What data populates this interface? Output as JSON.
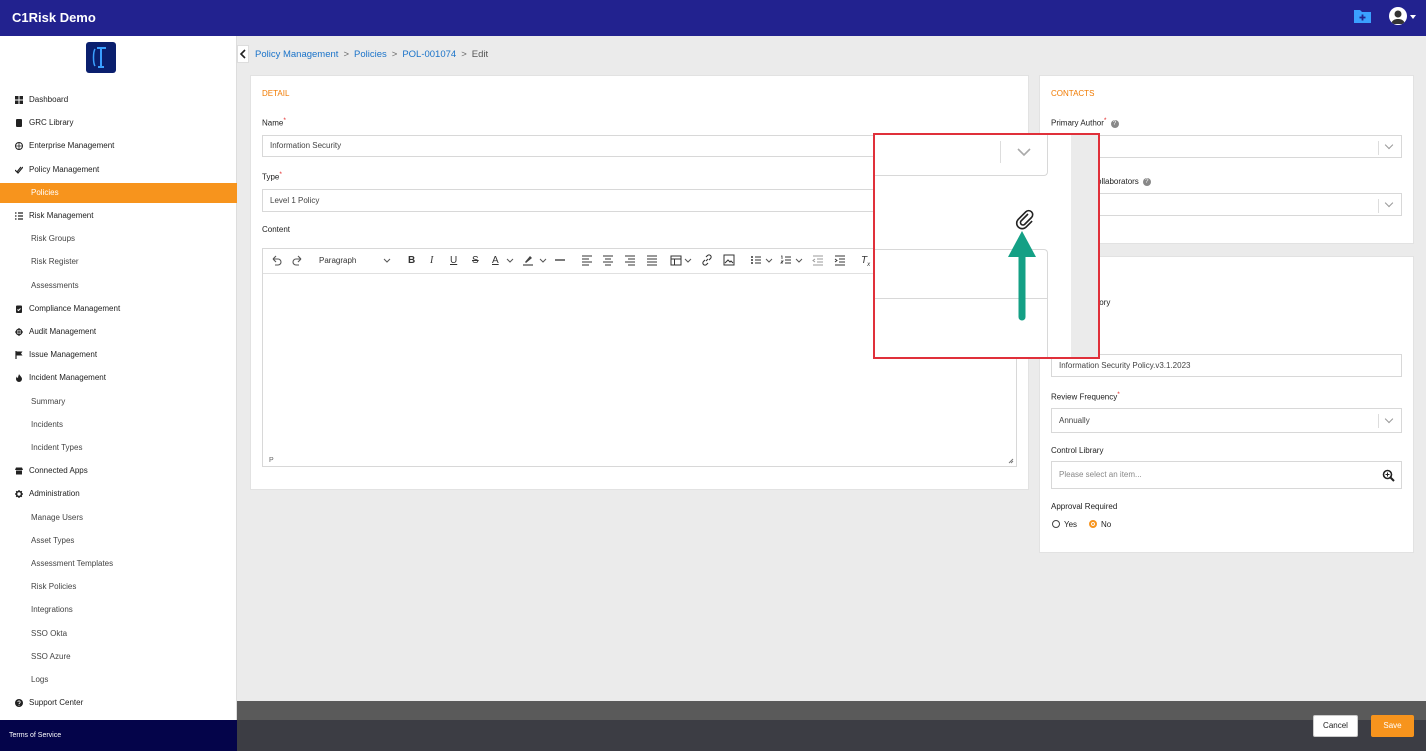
{
  "app": {
    "title": "C1Risk Demo"
  },
  "sidebar": {
    "items": [
      {
        "label": "Dashboard",
        "icon": "grid-icon"
      },
      {
        "label": "GRC Library",
        "icon": "book-icon"
      },
      {
        "label": "Enterprise Management",
        "icon": "globe-icon"
      },
      {
        "label": "Policy Management",
        "icon": "check-double-icon"
      },
      {
        "label": "Policies",
        "sub": true,
        "active": true
      },
      {
        "label": "Risk Management",
        "icon": "list-icon"
      },
      {
        "label": "Risk Groups",
        "sub": true
      },
      {
        "label": "Risk Register",
        "sub": true
      },
      {
        "label": "Assessments",
        "sub": true
      },
      {
        "label": "Compliance Management",
        "icon": "clipboard-check-icon"
      },
      {
        "label": "Audit Management",
        "icon": "crosshair-icon"
      },
      {
        "label": "Issue Management",
        "icon": "flag-icon"
      },
      {
        "label": "Incident Management",
        "icon": "fire-icon"
      },
      {
        "label": "Summary",
        "sub": true
      },
      {
        "label": "Incidents",
        "sub": true
      },
      {
        "label": "Incident Types",
        "sub": true
      },
      {
        "label": "Connected Apps",
        "icon": "store-icon"
      },
      {
        "label": "Administration",
        "icon": "gear-icon"
      },
      {
        "label": "Manage Users",
        "sub": true
      },
      {
        "label": "Asset Types",
        "sub": true
      },
      {
        "label": "Assessment Templates",
        "sub": true
      },
      {
        "label": "Risk Policies",
        "sub": true
      },
      {
        "label": "Integrations",
        "sub": true
      },
      {
        "label": "SSO Okta",
        "sub": true
      },
      {
        "label": "SSO Azure",
        "sub": true
      },
      {
        "label": "Logs",
        "sub": true
      },
      {
        "label": "Support Center",
        "icon": "question-circle-icon"
      }
    ],
    "terms": "Terms of Service"
  },
  "breadcrumb": {
    "items": [
      "Policy Management",
      "Policies",
      "POL-001074"
    ],
    "current": "Edit"
  },
  "detail": {
    "section_title": "DETAIL",
    "name_label": "Name",
    "name_value": "Information Security",
    "type_label": "Type",
    "type_value": "Level 1 Policy",
    "content_label": "Content",
    "editor": {
      "block_format": "Paragraph",
      "status_path": "P"
    }
  },
  "contacts": {
    "section_title": "CONTACTS",
    "primary_author_label": "Primary Author",
    "collaborators_label": "ollaborators"
  },
  "settings": {
    "history_label": "tory",
    "version_value": "Information Security Policy.v3.1.2023",
    "review_frequency_label": "Review Frequency",
    "review_frequency_value": "Annually",
    "control_library_label": "Control Library",
    "control_library_placeholder": "Please select an item...",
    "approval_label": "Approval Required",
    "approval_yes": "Yes",
    "approval_no": "No",
    "approval_selected": "No"
  },
  "footer": {
    "cancel": "Cancel",
    "save": "Save"
  },
  "colors": {
    "topbar": "#22228f",
    "accent": "#f7941d",
    "link": "#1a73c9",
    "annotation_arrow": "#14a085",
    "annotation_box": "#e0303a"
  }
}
